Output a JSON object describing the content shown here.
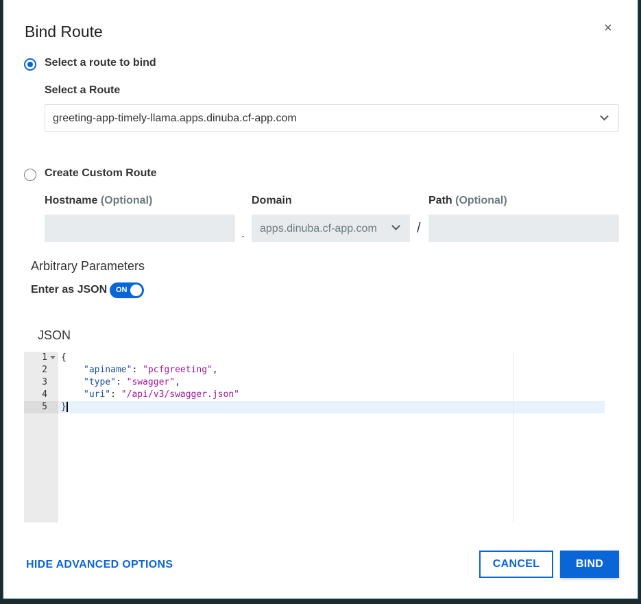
{
  "dialog": {
    "title": "Bind Route",
    "close_icon": "×"
  },
  "select_route": {
    "radio_label": "Select a route to bind",
    "field_label": "Select a Route",
    "value": "greeting-app-timely-llama.apps.dinuba.cf-app.com"
  },
  "custom_route": {
    "radio_label": "Create Custom Route",
    "hostname_label": "Hostname",
    "optional": "(Optional)",
    "domain_label": "Domain",
    "domain_value": "apps.dinuba.cf-app.com",
    "path_label": "Path",
    "dot": ".",
    "slash": "/"
  },
  "params": {
    "heading": "Arbitrary Parameters",
    "json_toggle_label": "Enter as JSON",
    "toggle_state": "ON",
    "json_label": "JSON"
  },
  "editor": {
    "line_numbers": [
      "1",
      "2",
      "3",
      "4",
      "5"
    ],
    "lines": [
      {
        "open": "{"
      },
      {
        "key": "\"apiname\"",
        "value": "\"pcfgreeting\"",
        "comma": ","
      },
      {
        "key": "\"type\"",
        "value": "\"swagger\"",
        "comma": ","
      },
      {
        "key": "\"uri\"",
        "value": "\"/api/v3/swagger.json\"",
        "comma": ""
      },
      {
        "close": "}"
      }
    ]
  },
  "footer": {
    "hide_advanced": "HIDE ADVANCED OPTIONS",
    "cancel": "CANCEL",
    "bind": "BIND"
  },
  "colors": {
    "accent": "#0a66d6"
  }
}
